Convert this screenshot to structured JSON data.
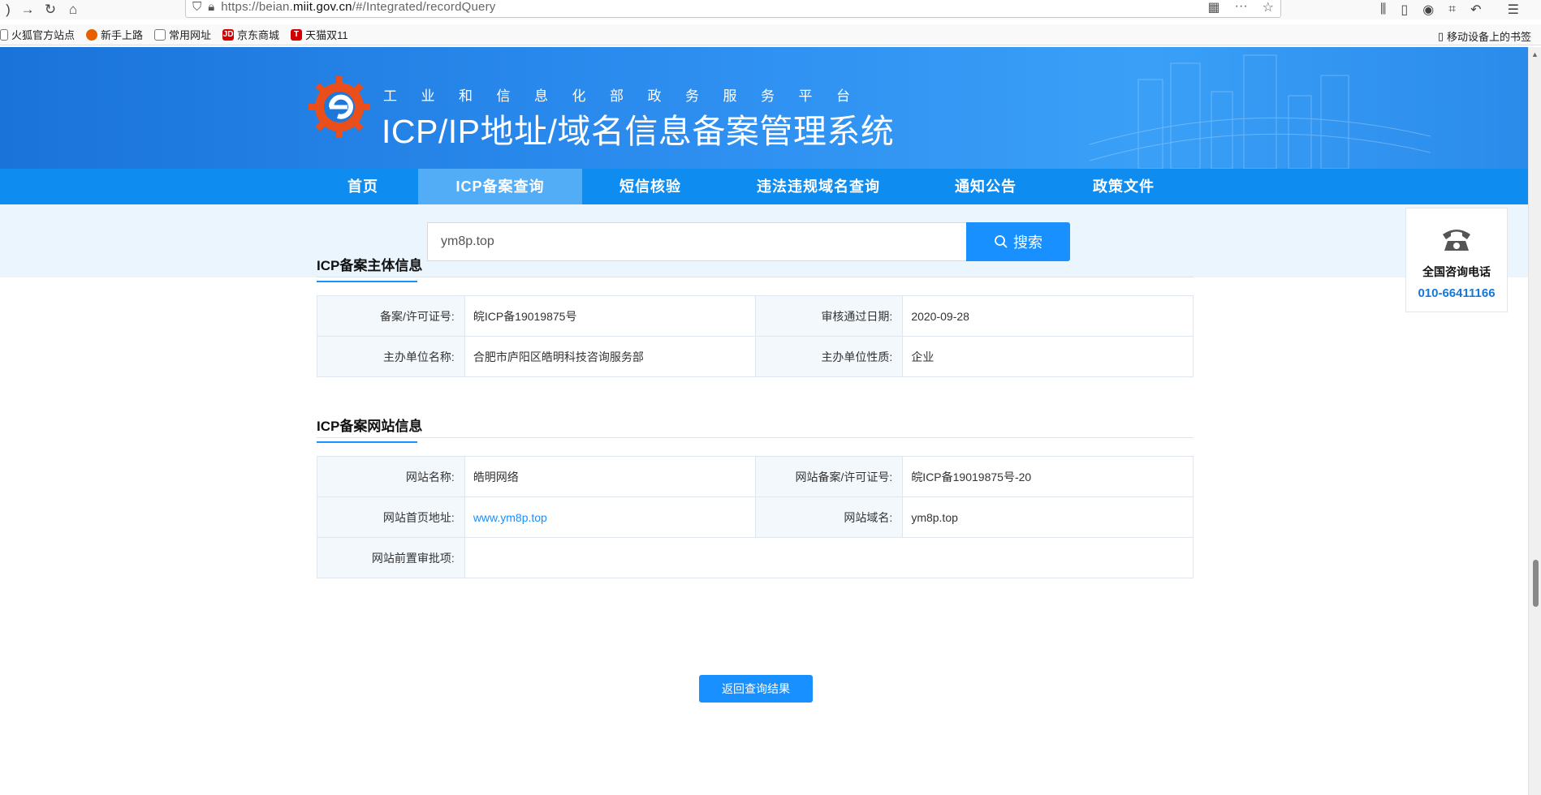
{
  "browser": {
    "url_prefix": "https://beian.",
    "url_domain": "miit.gov.cn",
    "url_suffix": "/#/Integrated/recordQuery",
    "bookmarks": [
      "火狐官方站点",
      "新手上路",
      "常用网址",
      "京东商城",
      "天猫双11"
    ],
    "mobile_bookmarks": "移动设备上的书签"
  },
  "header": {
    "subtitle": "工业和信息化部政务服务平台",
    "title": "ICP/IP地址/域名信息备案管理系统"
  },
  "nav": {
    "items": [
      "首页",
      "ICP备案查询",
      "短信核验",
      "违法违规域名查询",
      "通知公告",
      "政策文件"
    ],
    "active_index": 1
  },
  "search": {
    "value": "ym8p.top",
    "button_label": "搜索"
  },
  "hotline": {
    "label": "全国咨询电话",
    "number": "010-66411166"
  },
  "subject_info": {
    "title": "ICP备案主体信息",
    "rows": [
      [
        {
          "k": "备案/许可证号:",
          "v": "皖ICP备19019875号"
        },
        {
          "k": "审核通过日期:",
          "v": "2020-09-28"
        }
      ],
      [
        {
          "k": "主办单位名称:",
          "v": "合肥市庐阳区皓明科技咨询服务部"
        },
        {
          "k": "主办单位性质:",
          "v": "企业"
        }
      ]
    ]
  },
  "site_info": {
    "title": "ICP备案网站信息",
    "site_name_label": "网站名称:",
    "site_name": "皓明网络",
    "site_license_label": "网站备案/许可证号:",
    "site_license": "皖ICP备19019875号-20",
    "homepage_label": "网站首页地址:",
    "homepage": "www.ym8p.top",
    "domain_label": "网站域名:",
    "domain": "ym8p.top",
    "preapproval_label": "网站前置审批项:",
    "preapproval": ""
  },
  "back_button": "返回查询结果",
  "colors": {
    "nav_bg": "#0f8cf0",
    "nav_active": "#52adf6",
    "primary": "#1890ff",
    "banner": "#1a73d9"
  }
}
